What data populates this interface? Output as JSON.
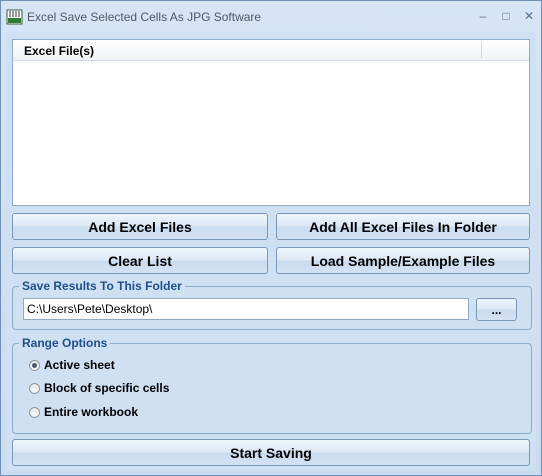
{
  "window": {
    "title": "Excel Save Selected Cells As JPG Software",
    "minimize_glyph": "–",
    "maximize_glyph": "□",
    "close_glyph": "✕"
  },
  "file_list": {
    "column_header": "Excel File(s)",
    "items": []
  },
  "buttons": {
    "add_files": "Add Excel Files",
    "add_folder": "Add All Excel Files In Folder",
    "clear_list": "Clear List",
    "load_samples": "Load Sample/Example Files",
    "browse": "...",
    "start": "Start Saving"
  },
  "save_folder": {
    "legend": "Save Results To This Folder",
    "path": "C:\\Users\\Pete\\Desktop\\"
  },
  "range_options": {
    "legend": "Range Options",
    "options": [
      {
        "label": "Active sheet",
        "selected": true
      },
      {
        "label": "Block of specific cells",
        "selected": false
      },
      {
        "label": "Entire workbook",
        "selected": false
      }
    ]
  }
}
